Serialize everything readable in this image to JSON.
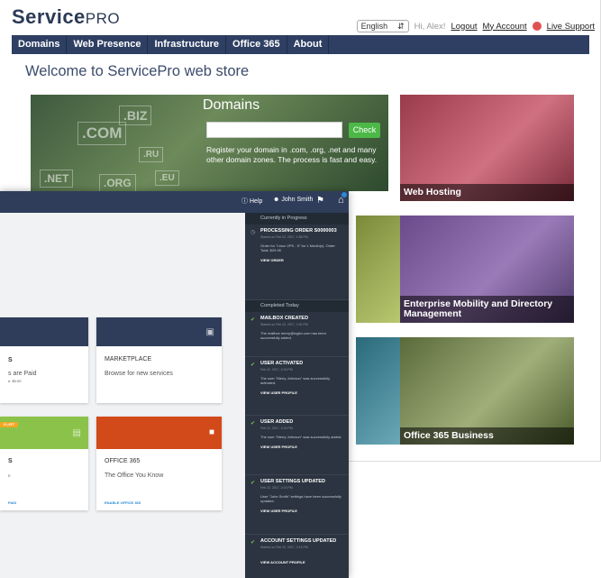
{
  "store": {
    "brand_bold": "Service",
    "brand_light": "PRO",
    "language": "English",
    "greeting": "Hi, Alex!",
    "logout": "Logout",
    "account": "My Account",
    "support": "Live Support",
    "nav": [
      "Domains",
      "Web Presence",
      "Infrastructure",
      "Office 365",
      "About"
    ],
    "welcome": "Welcome to ServicePro web store",
    "hero": {
      "title": "Domains",
      "check": "Check",
      "desc": "Register your domain in .com, .org, .net and many other domain zones. The process is fast and easy.",
      "tags": [
        ".COM",
        ".BIZ",
        ".NET",
        ".ORG",
        ".RU",
        ".EU"
      ]
    },
    "tiles": [
      "Web Hosting",
      "Enterprise Mobility and Directory Management",
      "Office 365 Business"
    ]
  },
  "dash": {
    "help": "Help",
    "user": "John Smith",
    "cards": {
      "c1_title": "S",
      "c1_sub": "s are Paid",
      "c1_note": "e: $0.00",
      "marketplace_title": "MARKETPLACE",
      "marketplace_sub": "Browse for new services",
      "c3_badge": "S LEFT",
      "c3_title": "S",
      "c3_sub": "n",
      "c3_link": "PAID",
      "office_title": "OFFICE 365",
      "office_sub": "The Office You Know",
      "office_link": "ENABLE OFFICE 365"
    },
    "notifications": {
      "in_progress_label": "Currently in Progress",
      "completed_label": "Completed Today",
      "progress": [
        {
          "title": "PROCESSING ORDER S0000003",
          "date": "Started on Feb 22, 2017, 1:55 PM",
          "body": "Order for \"Linux VPS - 5\" for 1 Month(s). Order Total: $29.99",
          "link": "VIEW ORDER"
        }
      ],
      "completed": [
        {
          "title": "MAILBOX CREATED",
          "date": "Started on Feb 22, 2017, 2:30 PM",
          "body": "The mailbox merry@ingler.com has been successfully added.",
          "link": ""
        },
        {
          "title": "USER ACTIVATED",
          "date": "Feb 22, 2017, 2:19 PM",
          "body": "The user \"Merry Johnson\" was successfully activated.",
          "link": "VIEW USER PROFILE"
        },
        {
          "title": "USER ADDED",
          "date": "Feb 22, 2017, 2:15 PM",
          "body": "The user \"Merry Johnson\" was successfully added.",
          "link": "VIEW USER PROFILE"
        },
        {
          "title": "USER SETTINGS UPDATED",
          "date": "Feb 22, 2017, 2:15 PM",
          "body": "User \"John Smith\" settings have been successfully updated.",
          "link": "VIEW USER PROFILE"
        },
        {
          "title": "ACCOUNT SETTINGS UPDATED",
          "date": "Started on Feb 22, 2017, 2:14 PM",
          "body": "",
          "link": "VIEW ACCOUNT PROFILE"
        }
      ]
    }
  }
}
